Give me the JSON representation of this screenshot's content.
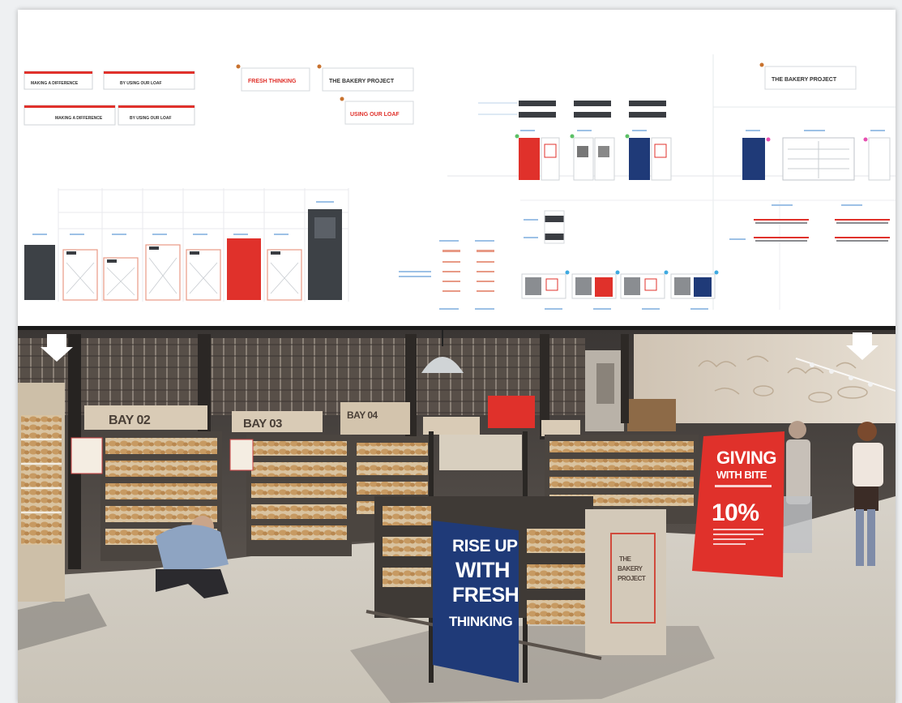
{
  "signage": {
    "header_1a": "MAKING A DIFFERENCE",
    "header_1b": "BY USING OUR LOAF",
    "header_2a": "MAKING A DIFFERENCE",
    "header_2b": "BY USING OUR LOAF",
    "fresh_thinking": "FRESH THINKING",
    "bakery_project": "THE BAKERY PROJECT",
    "using_our_loaf": "USING OUR LOAF",
    "bakery_project_right": "THE BAKERY PROJECT"
  },
  "bays": {
    "bay_02": "BAY 02",
    "bay_03": "BAY 03",
    "bay_04": "BAY 04"
  },
  "posters": {
    "rise_up": [
      "RISE UP",
      "WITH",
      "FRESH",
      "THINKING"
    ],
    "giving": [
      "GIVING",
      "WITH BITE"
    ],
    "percent": "10%",
    "bakery_project_panel": [
      "THE",
      "BAKERY",
      "PROJECT"
    ]
  },
  "colors": {
    "accent_red": "#e0312b",
    "navy": "#1f3a78",
    "dark_grey": "#3d4146"
  }
}
